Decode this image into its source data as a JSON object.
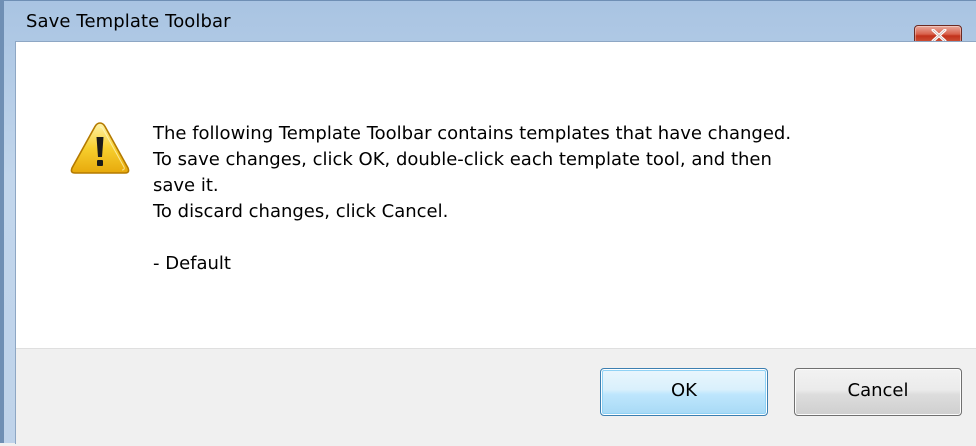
{
  "window": {
    "title": "Save Template Toolbar",
    "close_icon": "close-icon"
  },
  "dialog": {
    "icon": "warning-icon",
    "message_lines": [
      "The following Template Toolbar contains templates that have changed.",
      "To save changes, click OK, double-click each template tool, and then",
      "save it.",
      "To discard changes, click Cancel.",
      "",
      "- Default"
    ]
  },
  "buttons": {
    "ok_label": "OK",
    "cancel_label": "Cancel"
  },
  "colors": {
    "titlebar": "#bfd3ea",
    "close_button": "#c2321b",
    "warning_fill": "#f5c518",
    "ok_border": "#3c7fb1"
  }
}
